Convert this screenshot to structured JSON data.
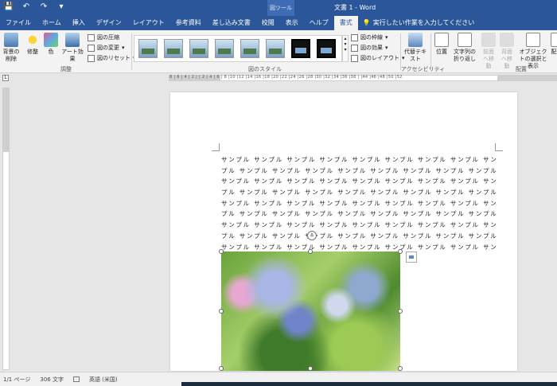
{
  "titlebar": {
    "qat": [
      "💾",
      "↶",
      "↷",
      "▾"
    ],
    "context_tool": "図ツール",
    "title": "文書 1 - Word"
  },
  "tabs": [
    {
      "label": "ファイル"
    },
    {
      "label": "ホーム"
    },
    {
      "label": "挿入"
    },
    {
      "label": "デザイン"
    },
    {
      "label": "レイアウト"
    },
    {
      "label": "参考資料"
    },
    {
      "label": "差し込み文書"
    },
    {
      "label": "校閲"
    },
    {
      "label": "表示"
    },
    {
      "label": "ヘルプ"
    },
    {
      "label": "書式"
    }
  ],
  "tell_me": "実行したい作業を入力してください",
  "ribbon": {
    "adjust": {
      "remove_bg": "背景の削除",
      "corrections": "修整",
      "color": "色",
      "art_effects": "アート効果",
      "compress": "図の圧縮",
      "change": "図の変更",
      "reset": "図のリセット",
      "label": "調整"
    },
    "styles_label": "図のスタイル",
    "border": "図の枠線",
    "effects": "図の効果",
    "layout": "図のレイアウト",
    "accessibility": {
      "alt_text": "代替テキスト",
      "label": "アクセシビリティ"
    },
    "arrange": {
      "position": "位置",
      "wrap_text": "文字列の折り返し",
      "bring_forward": "前面へ移動",
      "send_backward": "背面へ移動",
      "selection_pane": "オブジェクトの選択と表示",
      "label": "配置",
      "align": "配"
    }
  },
  "ruler": {
    "corner": "L",
    "numbers": "8 | 6 | 4 | 2 |  | 2 | 4 | 6 | 8 |10 |12 |14 |16 |18 |20 |22 |24 |26 |28 |30 |32 |34 |36 |38 |  |44 |46 |48 |50 |52"
  },
  "document": {
    "lines": [
      "サンプル サンプル サンプル サンプル サンプル サンプル サンプル サンプル サン",
      "プル サンプル サンプル サンプル サンプル サンプル サンプル サンプル サンプル",
      "サンプル サンプル サンプル サンプル サンプル サンプル サンプル サンプル サン",
      "プル サンプル サンプル サンプル サンプル サンプル サンプル サンプル サンプル",
      "サンプル サンプル サンプル サンプル サンプル サンプル サンプル サンプル サン",
      "プル サンプル サンプル サンプル サンプル サンプル サンプル サンプル サンプル",
      "サンプル サンプル サンプル サンプル サンプル サンプル サンプル サンプル サン",
      "プル サンプル サンプル サンプル サンプル サンプル サンプル サンプル サンプル",
      "サンプル サンプル サンプル サンプル サンプル サンプル サンプル サンプル サン"
    ],
    "anchor_icon": "⚓"
  },
  "status": {
    "page": "1/1 ページ",
    "words": "306 文字",
    "language": "英語 (米国)"
  }
}
